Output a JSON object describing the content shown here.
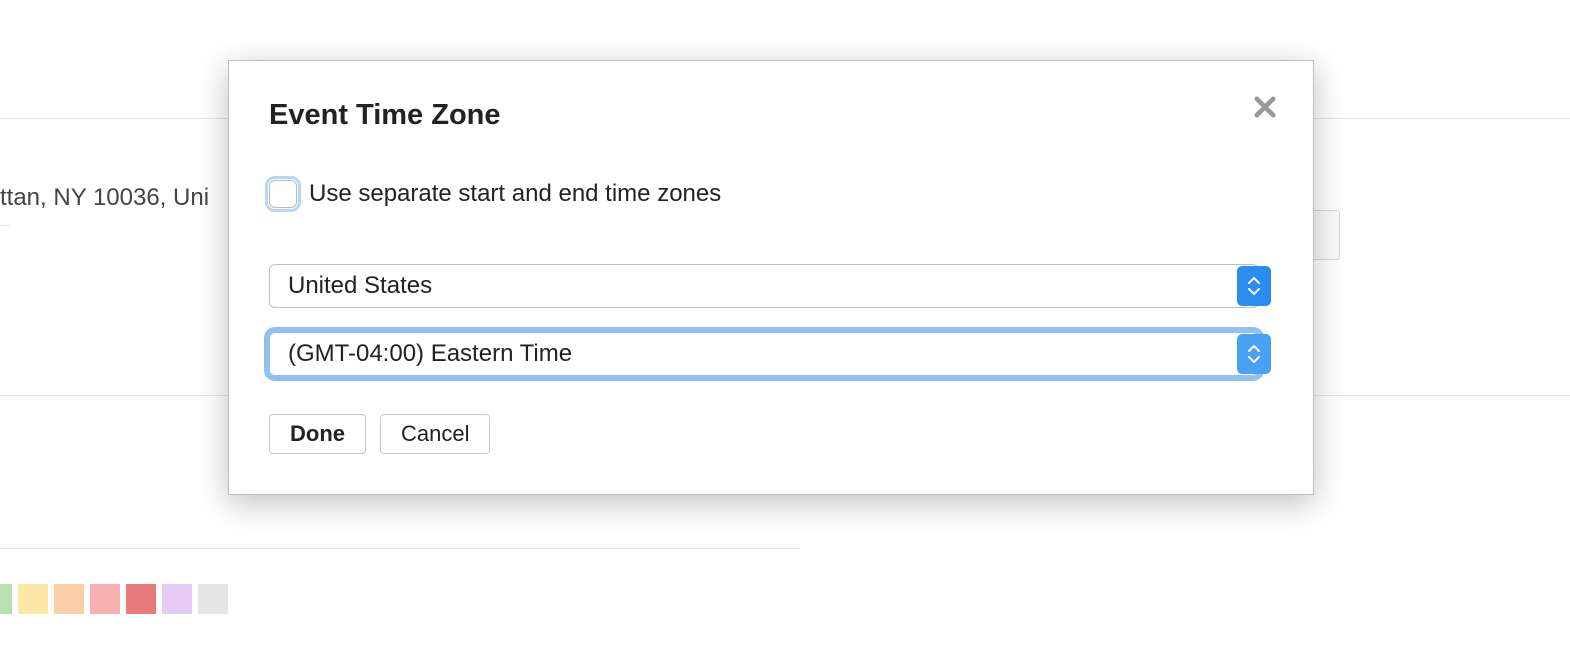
{
  "background": {
    "address_fragment": "ttan, NY 10036, Uni",
    "swatches": [
      "#b9e0b0",
      "#fbe8a6",
      "#fbd0a8",
      "#f7b1b1",
      "#e77a7a",
      "#e6ccf4",
      "#e6e6e6"
    ]
  },
  "dialog": {
    "title": "Event Time Zone",
    "checkbox_label": "Use separate start and end time zones",
    "country_select": "United States",
    "timezone_select": "(GMT-04:00) Eastern Time",
    "buttons": {
      "done": "Done",
      "cancel": "Cancel"
    }
  }
}
